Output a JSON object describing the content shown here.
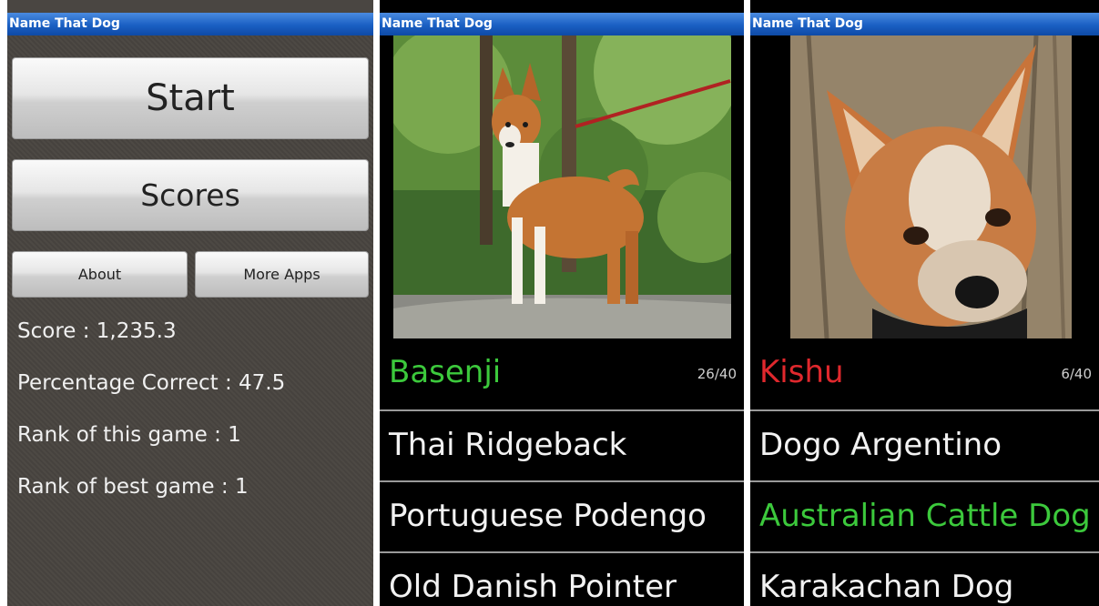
{
  "app_title": "Name That Dog",
  "menu": {
    "start_label": "Start",
    "scores_label": "Scores",
    "about_label": "About",
    "more_apps_label": "More Apps",
    "stats": [
      "Score : 1,235.3",
      "Percentage Correct : 47.5",
      "Rank of this game : 1",
      "Rank of best game : 1"
    ]
  },
  "quiz1": {
    "answer": "Basenji",
    "answer_color": "#3cc93c",
    "progress": "26/40",
    "options": [
      "Thai Ridgeback",
      "Portuguese Podengo",
      "Old Danish Pointer"
    ]
  },
  "quiz2": {
    "answer": "Kishu",
    "answer_color": "#e0282d",
    "progress": "6/40",
    "options": [
      "Dogo Argentino",
      "Australian Cattle Dog",
      "Karakachan Dog"
    ],
    "correct_option_color": "#3cc93c"
  }
}
